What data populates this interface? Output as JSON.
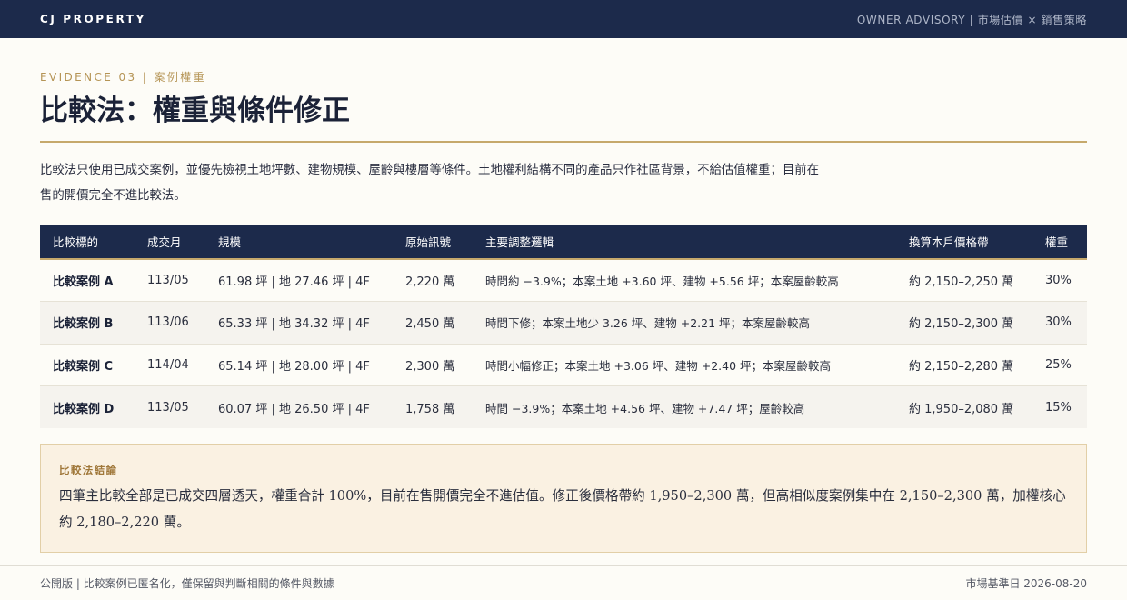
{
  "header": {
    "brand": "CJ PROPERTY",
    "tagline": "OWNER ADVISORY | 市場估價 × 銷售策略"
  },
  "section": {
    "eyebrow": "EVIDENCE 03 | 案例權重",
    "title": "比較法：權重與條件修正",
    "intro": "比較法只使用已成交案例，並優先檢視土地坪數、建物規模、屋齡與樓層等條件。土地權利結構不同的產品只作社區背景，不給估值權重；目前在售的開價完全不進比較法。"
  },
  "table": {
    "headers": [
      "比較標的",
      "成交月",
      "規模",
      "原始訊號",
      "主要調整邏輯",
      "換算本戶價格帶",
      "權重"
    ],
    "rows": [
      {
        "case": "比較案例 A",
        "month": "113/05",
        "scale": "61.98 坪 | 地 27.46 坪 | 4F",
        "signal": "2,220 萬",
        "adjust": "時間約 −3.9%；本案土地 +3.60 坪、建物 +5.56 坪；本案屋齡較高",
        "band": "約 2,150–2,250 萬",
        "weight": "30%"
      },
      {
        "case": "比較案例 B",
        "month": "113/06",
        "scale": "65.33 坪 | 地 34.32 坪 | 4F",
        "signal": "2,450 萬",
        "adjust": "時間下修；本案土地少 3.26 坪、建物 +2.21 坪；本案屋齡較高",
        "band": "約 2,150–2,300 萬",
        "weight": "30%"
      },
      {
        "case": "比較案例 C",
        "month": "114/04",
        "scale": "65.14 坪 | 地 28.00 坪 | 4F",
        "signal": "2,300 萬",
        "adjust": "時間小幅修正；本案土地 +3.06 坪、建物 +2.40 坪；本案屋齡較高",
        "band": "約 2,150–2,280 萬",
        "weight": "25%"
      },
      {
        "case": "比較案例 D",
        "month": "113/05",
        "scale": "60.07 坪 | 地 26.50 坪 | 4F",
        "signal": "1,758 萬",
        "adjust": "時間 −3.9%；本案土地 +4.56 坪、建物 +7.47 坪；屋齡較高",
        "band": "約 1,950–2,080 萬",
        "weight": "15%"
      }
    ]
  },
  "conclusion": {
    "label": "比較法結論",
    "text": "四筆主比較全部是已成交四層透天，權重合計 100%，目前在售開價完全不進估值。修正後價格帶約 1,950–2,300 萬，但高相似度案例集中在 2,150–2,300 萬，加權核心約 2,180–2,220 萬。"
  },
  "footer": {
    "left": "公開版 | 比較案例已匿名化，僅保留與判斷相關的條件與數據",
    "right": "市場基準日 2026-08-20"
  },
  "colors": {
    "navy": "#1c2a4b",
    "gold": "#c6a96c",
    "background": "#fdfcf7",
    "conclusion_bg": "#faf1e2"
  }
}
